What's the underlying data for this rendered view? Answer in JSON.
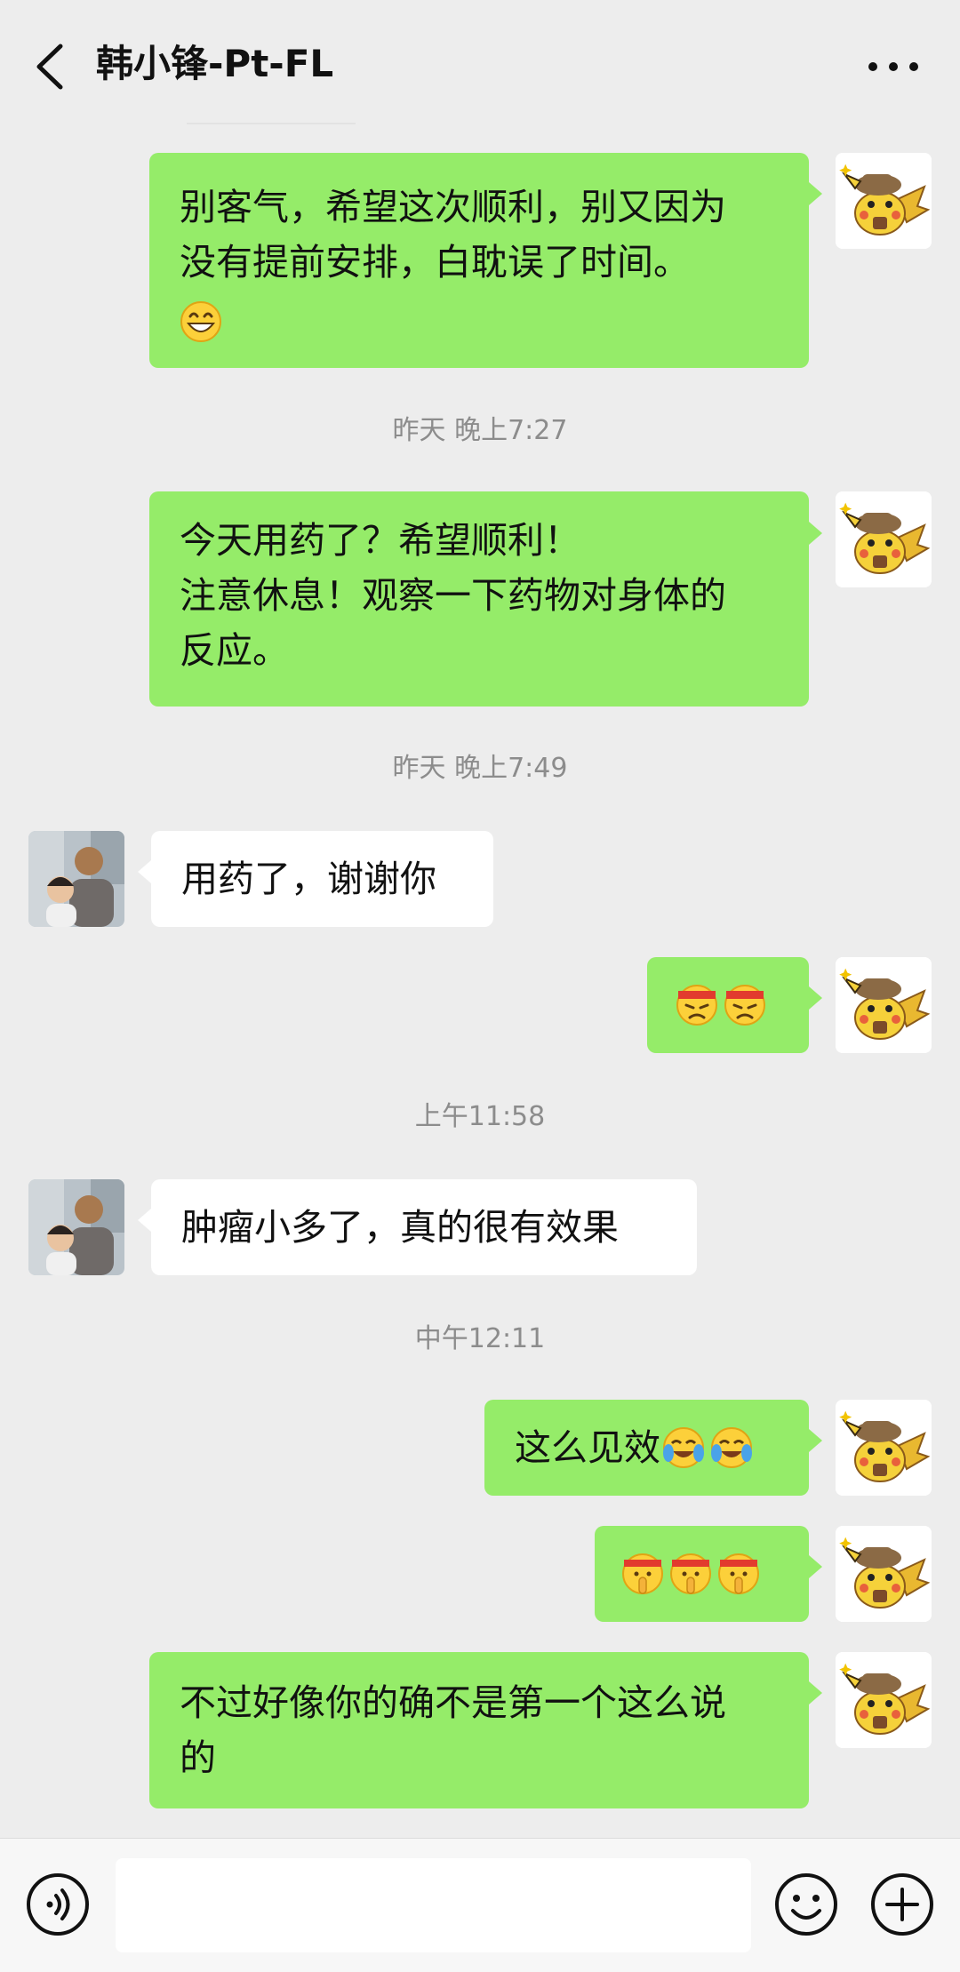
{
  "header": {
    "title": "韩小锋-Pt-FL",
    "back_icon": "chevron-left-icon",
    "more_icon": "more-dots-icon"
  },
  "messages": [
    {
      "from": "me",
      "text": "别客气，希望这次顺利，别又因为\n没有提前安排，白耽误了时间。",
      "emoji": [
        "grin"
      ]
    },
    {
      "timestamp": "昨天 晚上7:27"
    },
    {
      "from": "me",
      "text": "今天用药了？希望顺利！\n注意休息！观察一下药物对身体的\n反应。"
    },
    {
      "timestamp": "昨天 晚上7:49"
    },
    {
      "from": "them",
      "text": "用药了，谢谢你"
    },
    {
      "from": "me",
      "text": "",
      "emoji": [
        "headband-frown",
        "headband-frown"
      ]
    },
    {
      "timestamp": "上午11:58"
    },
    {
      "from": "them",
      "text": "肿瘤小多了，真的很有效果"
    },
    {
      "timestamp": "中午12:11"
    },
    {
      "from": "me",
      "text": "这么见效",
      "emoji": [
        "crying-laugh",
        "crying-laugh"
      ]
    },
    {
      "from": "me",
      "text": "",
      "emoji": [
        "shush-headband",
        "shush-headband",
        "shush-headband"
      ]
    },
    {
      "from": "me",
      "text": "不过好像你的确不是第一个这么说\n的"
    }
  ],
  "input_bar": {
    "voice_icon": "voice-icon",
    "emoji_icon": "emoji-face-icon",
    "plus_icon": "plus-icon",
    "value": ""
  },
  "colors": {
    "background": "#ededed",
    "my_bubble": "#95ec69",
    "their_bubble": "#ffffff",
    "timestamp_text": "#8c8c8c"
  }
}
